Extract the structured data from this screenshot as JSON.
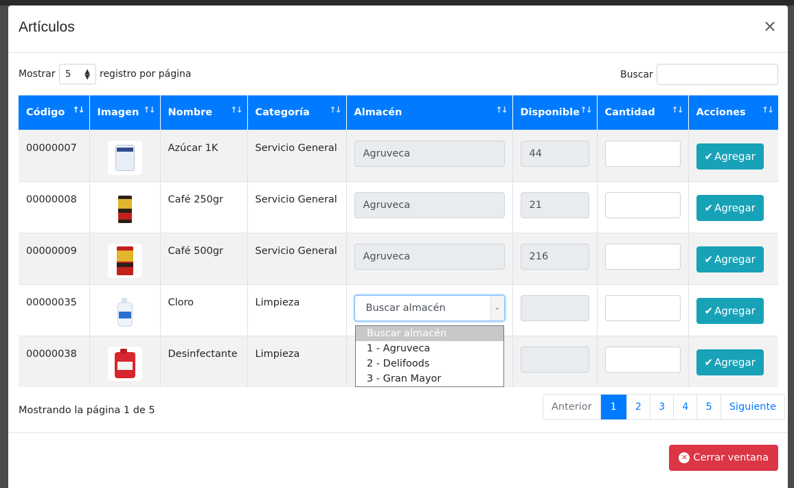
{
  "modal": {
    "title": "Artículos",
    "close_glyph": "×"
  },
  "controls": {
    "length_prefix": "Mostrar",
    "length_value": "5",
    "length_suffix": "registro por página",
    "search_label": "Buscar",
    "search_value": ""
  },
  "table": {
    "headers": [
      "Código",
      "Imagen",
      "Nombre",
      "Categoría",
      "Almacén",
      "Disponible",
      "Cantidad",
      "Acciones"
    ],
    "rows": [
      {
        "code": "00000007",
        "image_icon": "sugar-bag-icon",
        "name": "Azúcar 1K",
        "category": "Servicio General",
        "warehouse": "Agruveca",
        "available": "44",
        "quantity": "",
        "action": "Agregar"
      },
      {
        "code": "00000008",
        "image_icon": "coffee-bag-icon",
        "name": "Café 250gr",
        "category": "Servicio General",
        "warehouse": "Agruveca",
        "available": "21",
        "quantity": "",
        "action": "Agregar"
      },
      {
        "code": "00000009",
        "image_icon": "coffee-bag-icon",
        "name": "Café 500gr",
        "category": "Servicio General",
        "warehouse": "Agruveca",
        "available": "216",
        "quantity": "",
        "action": "Agregar"
      },
      {
        "code": "00000035",
        "image_icon": "bleach-bottle-icon",
        "name": "Cloro",
        "category": "Limpieza",
        "warehouse": "Buscar almacén",
        "available": "",
        "quantity": "",
        "action": "Agregar"
      },
      {
        "code": "00000038",
        "image_icon": "disinfectant-jug-icon",
        "name": "Desinfectante",
        "category": "Limpieza",
        "warehouse": "",
        "available": "",
        "quantity": "",
        "action": "Agregar"
      }
    ]
  },
  "dropdown": {
    "options": [
      "Buscar almacén",
      "1 - Agruveca",
      "2 - Delifoods",
      "3 - Gran Mayor"
    ],
    "highlighted": "Buscar almacén"
  },
  "footer": {
    "info": "Mostrando la página 1 de 5",
    "pager": [
      "Anterior",
      "1",
      "2",
      "3",
      "4",
      "5",
      "Siguiente"
    ],
    "active_page": "1",
    "close_button": "Cerrar ventana"
  },
  "colors": {
    "header_blue": "#007bff",
    "add_teal": "#17a2b8",
    "close_red": "#dc3545"
  }
}
